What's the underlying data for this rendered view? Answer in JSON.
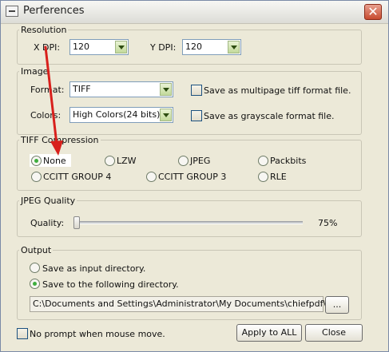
{
  "window": {
    "title": "Perferences",
    "close_glyph": "✕"
  },
  "resolution": {
    "legend": "Resolution",
    "xdpi_label": "X DPI:",
    "xdpi_value": "120",
    "ydpi_label": "Y DPI:",
    "ydpi_value": "120"
  },
  "image": {
    "legend": "Image",
    "format_label": "Format:",
    "format_value": "TIFF",
    "colors_label": "Colors:",
    "colors_value": "High Colors(24 bits)",
    "multipage_label": "Save as multipage tiff format file.",
    "grayscale_label": "Save as grayscale format file.",
    "multipage_checked": false,
    "grayscale_checked": false
  },
  "tiff": {
    "legend": "TIFF Compression",
    "options": [
      "None",
      "LZW",
      "JPEG",
      "Packbits",
      "CCITT GROUP 4",
      "CCITT GROUP 3",
      "RLE"
    ],
    "selected": "None"
  },
  "jpeg": {
    "legend": "JPEG Quality",
    "quality_label": "Quality:",
    "quality_value": "75%",
    "slider_fraction": 0.0
  },
  "output": {
    "legend": "Output",
    "opt_input": "Save as input directory.",
    "opt_following": "Save to the following directory.",
    "selected": "following",
    "path": "C:\\Documents and Settings\\Administrator\\My Documents\\chiefpdf\\",
    "browse": "..."
  },
  "footer": {
    "no_prompt_label": "No prompt when mouse move.",
    "no_prompt_checked": false,
    "apply_label": "Apply to ALL",
    "close_label": "Close"
  },
  "colors": {
    "annotation_arrow": "#d8201c",
    "radio_dot": "#3eae3e"
  }
}
